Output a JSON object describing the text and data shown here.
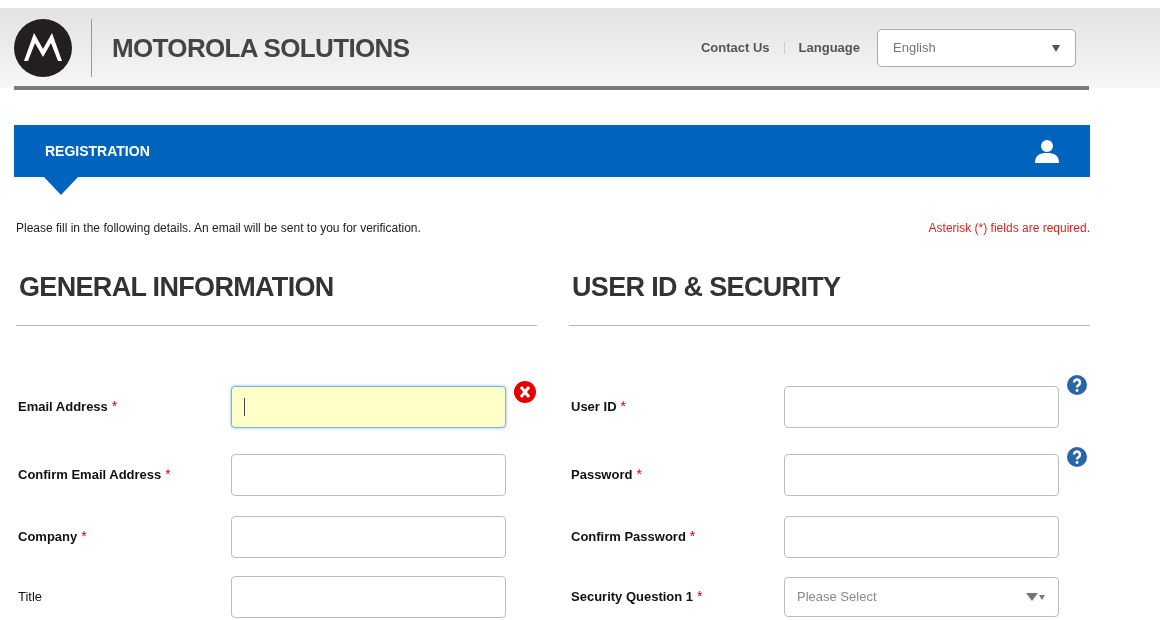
{
  "header": {
    "brand": "MOTOROLA SOLUTIONS",
    "links": [
      "Contact Us",
      "Language"
    ],
    "language_select": {
      "value": "English"
    }
  },
  "banner": {
    "title": "REGISTRATION"
  },
  "intro": "Please fill in the following details. An email will be sent to you for verification.",
  "required_note": "Asterisk (*) fields are required.",
  "sections": [
    {
      "heading": "GENERAL INFORMATION",
      "fields": [
        {
          "label": "Email Address",
          "required_mark": "*",
          "kind": "text",
          "focused": true,
          "error": true,
          "help": false
        },
        {
          "label": "Confirm Email Address",
          "required_mark": "*",
          "kind": "text",
          "focused": false,
          "error": false,
          "help": false
        },
        {
          "label": "Company",
          "required_mark": "*",
          "kind": "text",
          "focused": false,
          "error": false,
          "help": false
        },
        {
          "label": "Title",
          "kind": "text",
          "focused": false,
          "error": false,
          "help": false
        }
      ]
    },
    {
      "heading": "USER ID & SECURITY",
      "fields": [
        {
          "label": "User ID",
          "required_mark": "*",
          "kind": "text",
          "focused": false,
          "error": false,
          "help": true
        },
        {
          "label": "Password",
          "required_mark": "*",
          "kind": "text",
          "focused": false,
          "error": false,
          "help": true
        },
        {
          "label": "Confirm Password",
          "required_mark": "*",
          "kind": "text",
          "focused": false,
          "error": false,
          "help": false
        },
        {
          "label": "Security Question 1",
          "required_mark": "*",
          "kind": "select",
          "placeholder": "Please Select",
          "focused": false,
          "error": false,
          "help": false
        }
      ]
    }
  ]
}
